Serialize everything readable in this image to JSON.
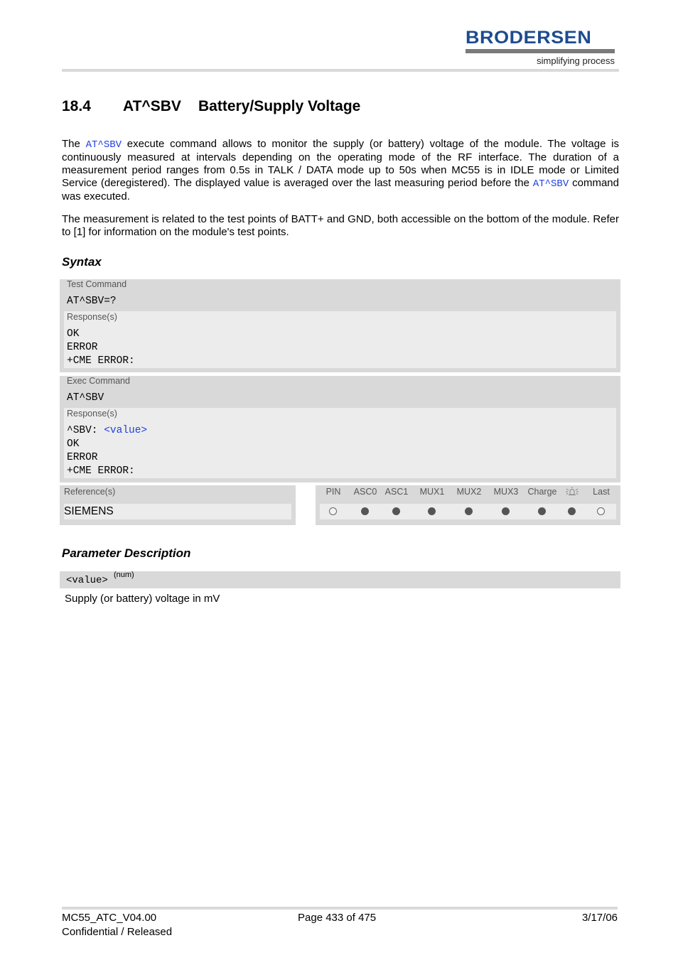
{
  "header": {
    "logo_text": "BRODERSEN",
    "logo_tagline": "simplifying process",
    "logo_color": "#1d4b8f"
  },
  "section": {
    "number": "18.4",
    "command": "AT^SBV",
    "title": "Battery/Supply Voltage"
  },
  "intro": {
    "p1_before": "The ",
    "p1_link": "AT^SBV",
    "p1_middle": " execute command allows to monitor the supply (or battery) voltage of the module. The voltage is continuously measured at intervals depending on the operating mode of the RF interface. The duration of a measurement period ranges from 0.5s in TALK / DATA mode up to 50s when MC55 is in IDLE mode or Limited Service (deregistered). The displayed value is averaged over the last measuring period before the ",
    "p1_link2": "AT^SBV",
    "p1_after": " command was executed.",
    "p2": "The measurement is related to the test points of BATT+ and GND, both accessible on the bottom of the module. Refer to [1] for information on the module's test points."
  },
  "syntax": {
    "heading": "Syntax",
    "test": {
      "label": "Test Command",
      "command": "AT^SBV=?",
      "response_label": "Response(s)",
      "responses": [
        "OK",
        "ERROR",
        "+CME ERROR:"
      ]
    },
    "exec": {
      "label": "Exec Command",
      "command": "AT^SBV",
      "response_label": "Response(s)",
      "response_prefix": "^SBV: ",
      "response_param": "<value>",
      "responses": [
        "OK",
        "ERROR",
        "+CME ERROR:"
      ]
    },
    "reference": {
      "label": "Reference(s)",
      "value": "SIEMENS"
    },
    "flags": {
      "headers": [
        "PIN",
        "ASC0",
        "ASC1",
        "MUX1",
        "MUX2",
        "MUX3",
        "Charge",
        "alarm-icon",
        "Last"
      ],
      "values": [
        false,
        true,
        true,
        true,
        true,
        true,
        true,
        true,
        false
      ]
    }
  },
  "parameters": {
    "heading": "Parameter Description",
    "items": [
      {
        "name": "<value>",
        "type": "(num)",
        "description": "Supply (or battery) voltage in mV"
      }
    ]
  },
  "footer": {
    "doc_id": "MC55_ATC_V04.00",
    "status": "Confidential / Released",
    "page": "Page 433 of 475",
    "date": "3/17/06"
  }
}
